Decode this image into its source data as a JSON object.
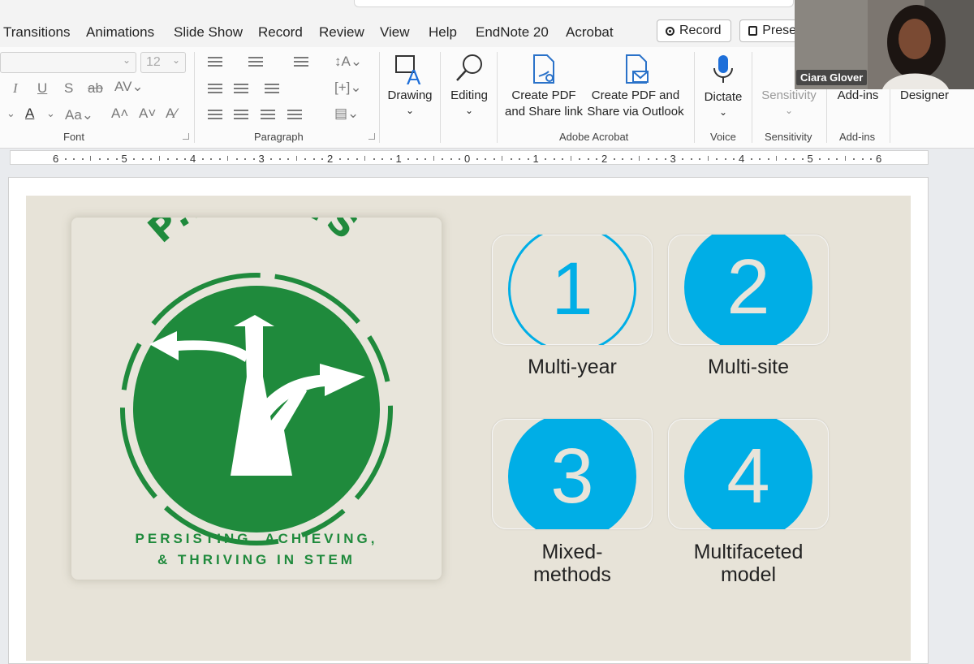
{
  "tabs": [
    "Transitions",
    "Animations",
    "Slide Show",
    "Record",
    "Review",
    "View",
    "Help",
    "EndNote 20",
    "Acrobat"
  ],
  "header_buttons": {
    "record": "Record",
    "present": "Prese"
  },
  "font": {
    "size": "12",
    "group_label": "Font"
  },
  "paragraph": {
    "group_label": "Paragraph"
  },
  "drawing": {
    "label": "Drawing"
  },
  "editing": {
    "label": "Editing"
  },
  "acrobat": {
    "create_share_link": [
      "Create PDF",
      "and Share link"
    ],
    "create_share_outlook": [
      "Create PDF and",
      "Share via Outlook"
    ],
    "group_label": "Adobe Acrobat"
  },
  "voice": {
    "dictate": "Dictate",
    "group_label": "Voice"
  },
  "sensitivity": {
    "button": "Sensitivity",
    "group_label": "Sensitivity"
  },
  "addins": {
    "button": "Add-ins",
    "group_label": "Add-ins"
  },
  "designer": {
    "button": "Designer"
  },
  "ruler": [
    "6",
    "5",
    "4",
    "3",
    "2",
    "1",
    "0",
    "1",
    "2",
    "3",
    "4",
    "5",
    "6"
  ],
  "participant": {
    "name": "Ciara Glover"
  },
  "slide": {
    "logo_title": "P.A.TH.S",
    "tagline_line1": "PERSISTING, ACHIEVING,",
    "tagline_line2": "& THRIVING IN STEM",
    "items": [
      {
        "number": "1",
        "caption": "Multi-year"
      },
      {
        "number": "2",
        "caption": "Multi-site"
      },
      {
        "number": "3",
        "caption_line1": "Mixed-",
        "caption_line2": "methods"
      },
      {
        "number": "4",
        "caption_line1": "Multifaceted",
        "caption_line2": "model"
      }
    ]
  },
  "colors": {
    "accent_blue": "#00aee6",
    "logo_green": "#1f8a3c",
    "slide_bg": "#e7e3d8"
  }
}
